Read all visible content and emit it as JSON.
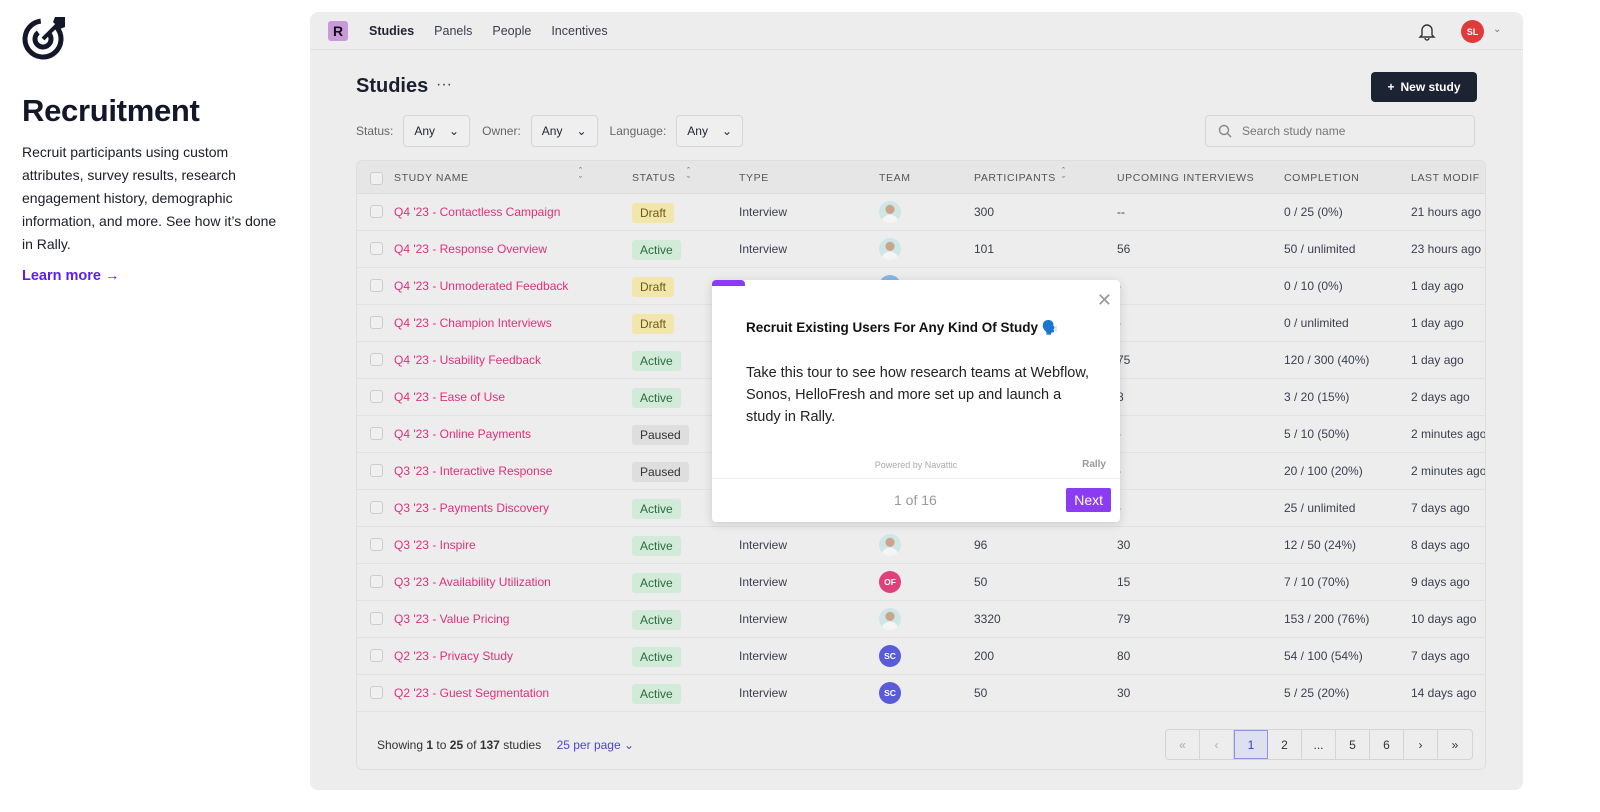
{
  "left": {
    "title": "Recruitment",
    "description": "Recruit participants using custom attributes, survey results, research engagement history, demographic information, and more. See how it’s done in Rally.",
    "learn_more": "Learn more →"
  },
  "nav": {
    "logo": "R",
    "items": [
      "Studies",
      "Panels",
      "People",
      "Incentives"
    ],
    "avatar": "SL",
    "avatar_color": "#e03a3a"
  },
  "page": {
    "title": "Studies",
    "more": "···",
    "new_study": "New study",
    "search_placeholder": "Search study name"
  },
  "filters": [
    {
      "label": "Status:",
      "value": "Any"
    },
    {
      "label": "Owner:",
      "value": "Any"
    },
    {
      "label": "Language:",
      "value": "Any"
    }
  ],
  "columns": [
    "STUDY NAME",
    "STATUS",
    "TYPE",
    "TEAM",
    "PARTICIPANTS",
    "UPCOMING INTERVIEWS",
    "COMPLETION",
    "LAST MODIF"
  ],
  "rows": [
    {
      "name": "Q4 '23 - Contactless Campaign",
      "status": "Draft",
      "type": "Interview",
      "team": "photo",
      "participants": "300",
      "upcoming": "--",
      "completion": "0 / 25 (0%)",
      "modified": "21 hours ago"
    },
    {
      "name": "Q4 '23 - Response Overview",
      "status": "Active",
      "type": "Interview",
      "team": "photo",
      "participants": "101",
      "upcoming": "56",
      "completion": "50 / unlimited",
      "modified": "23 hours ago"
    },
    {
      "name": "Q4 '23 - Unmoderated Feedback",
      "status": "Draft",
      "type": "",
      "team": "blue",
      "participants": "",
      "upcoming": "-",
      "completion": "0 / 10 (0%)",
      "modified": "1 day ago"
    },
    {
      "name": "Q4 '23 - Champion Interviews",
      "status": "Draft",
      "type": "",
      "team": "",
      "participants": "",
      "upcoming": "-",
      "completion": "0 / unlimited",
      "modified": "1 day ago"
    },
    {
      "name": "Q4 '23 - Usability Feedback",
      "status": "Active",
      "type": "",
      "team": "",
      "participants": "",
      "upcoming": "75",
      "completion": "120 / 300 (40%)",
      "modified": "1 day ago"
    },
    {
      "name": "Q4 '23 - Ease of Use",
      "status": "Active",
      "type": "",
      "team": "",
      "participants": "",
      "upcoming": "8",
      "completion": "3 / 20 (15%)",
      "modified": "2 days ago"
    },
    {
      "name": "Q4 '23 - Online Payments",
      "status": "Paused",
      "type": "",
      "team": "",
      "participants": "",
      "upcoming": "-",
      "completion": "5 / 10 (50%)",
      "modified": "2 minutes ago"
    },
    {
      "name": "Q3 '23 - Interactive Response",
      "status": "Paused",
      "type": "",
      "team": "",
      "participants": "",
      "upcoming": "-",
      "completion": "20 / 100 (20%)",
      "modified": "2 minutes ago"
    },
    {
      "name": "Q3 '23 - Payments Discovery",
      "status": "Active",
      "type": "",
      "team": "",
      "participants": "",
      "upcoming": "-",
      "completion": "25 / unlimited",
      "modified": "7 days ago"
    },
    {
      "name": "Q3 '23 - Inspire",
      "status": "Active",
      "type": "Interview",
      "team": "photo",
      "participants": "96",
      "upcoming": "30",
      "completion": "12 / 50 (24%)",
      "modified": "8 days ago"
    },
    {
      "name": "Q3 '23 - Availability Utilization",
      "status": "Active",
      "type": "Interview",
      "team": "OF",
      "team_color": "#e0407a",
      "participants": "50",
      "upcoming": "15",
      "completion": "7 / 10 (70%)",
      "modified": "9 days ago"
    },
    {
      "name": "Q3 '23 - Value Pricing",
      "status": "Active",
      "type": "Interview",
      "team": "photo",
      "participants": "3320",
      "upcoming": "79",
      "completion": "153 / 200 (76%)",
      "modified": "10 days ago"
    },
    {
      "name": "Q2 '23 - Privacy Study",
      "status": "Active",
      "type": "Interview",
      "team": "SC",
      "team_color": "#5a5bd8",
      "participants": "200",
      "upcoming": "80",
      "completion": "54 / 100 (54%)",
      "modified": "7 days ago"
    },
    {
      "name": "Q2 '23 - Guest Segmentation",
      "status": "Active",
      "type": "Interview",
      "team": "SC",
      "team_color": "#5a5bd8",
      "participants": "50",
      "upcoming": "30",
      "completion": "5 / 25 (20%)",
      "modified": "14 days ago"
    }
  ],
  "footer": {
    "showing": "Showing",
    "from": "1",
    "to_word": "to",
    "to": "25",
    "of_word": "of",
    "total": "137",
    "suffix": "studies",
    "per_page": "25 per page"
  },
  "pagination": [
    "«",
    "‹",
    "1",
    "2",
    "...",
    "5",
    "6",
    "›",
    "»"
  ],
  "pagination_current": "1",
  "tour": {
    "title": "Recruit Existing Users For Any Kind Of Study 🗣️",
    "body": "Take this tour to see how research teams at Webflow, Sonos, HelloFresh and more set up and launch a study in Rally.",
    "powered": "Powered by Navattic",
    "brand": "Rally",
    "step": "1 of 16",
    "step_current": 1,
    "step_total": 16,
    "next": "Next",
    "accent": "#8b3cf2"
  }
}
